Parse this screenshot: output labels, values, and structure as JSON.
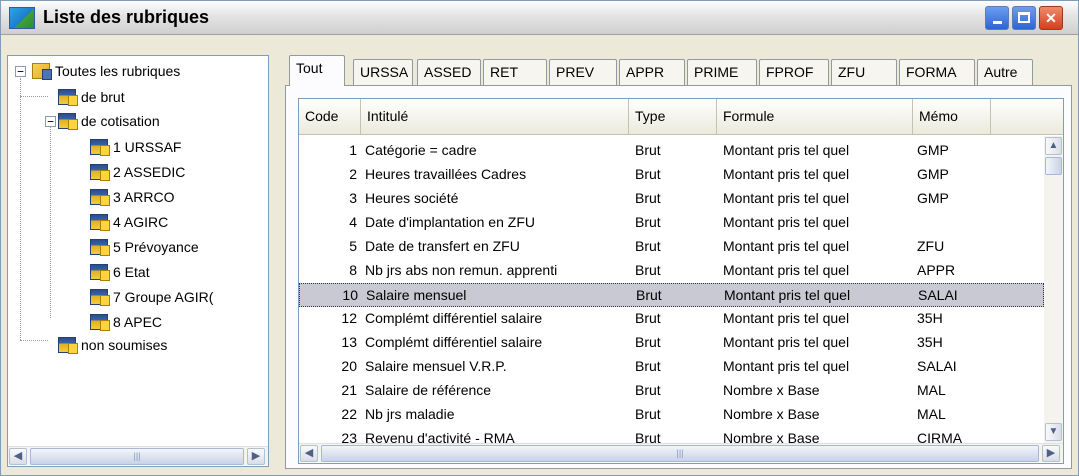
{
  "window": {
    "title": "Liste des rubriques"
  },
  "tree": {
    "root": "Toutes les rubriques",
    "brut": "de brut",
    "cotisation": "de cotisation",
    "children": [
      "1 URSSAF",
      "2 ASSEDIC",
      "3 ARRCO",
      "4 AGIRC",
      "5 Prévoyance",
      "6 Etat",
      "7 Groupe AGIR(",
      "8 APEC"
    ],
    "non_soumises": "non soumises"
  },
  "tabs": [
    "Tout",
    "URSSA",
    "ASSED",
    "RET",
    "PREV",
    "APPR",
    "PRIME",
    "FPROF",
    "ZFU",
    "FORMA",
    "Autre"
  ],
  "columns": [
    "Code",
    "Intitulé",
    "Type",
    "Formule",
    "Mémo"
  ],
  "rows": [
    {
      "code": "1",
      "intitule": "Catégorie = cadre",
      "type": "Brut",
      "formule": "Montant pris tel quel",
      "memo": "GMP"
    },
    {
      "code": "2",
      "intitule": "Heures travaillées Cadres",
      "type": "Brut",
      "formule": "Montant pris tel quel",
      "memo": "GMP"
    },
    {
      "code": "3",
      "intitule": "Heures société",
      "type": "Brut",
      "formule": "Montant pris tel quel",
      "memo": "GMP"
    },
    {
      "code": "4",
      "intitule": "Date d'implantation en ZFU",
      "type": "Brut",
      "formule": "Montant pris tel quel",
      "memo": ""
    },
    {
      "code": "5",
      "intitule": "Date de transfert en ZFU",
      "type": "Brut",
      "formule": "Montant pris tel quel",
      "memo": "ZFU"
    },
    {
      "code": "8",
      "intitule": "Nb jrs abs non remun. apprenti",
      "type": "Brut",
      "formule": "Montant pris tel quel",
      "memo": "APPR"
    },
    {
      "code": "10",
      "intitule": "Salaire mensuel",
      "type": "Brut",
      "formule": "Montant pris tel quel",
      "memo": "SALAI"
    },
    {
      "code": "12",
      "intitule": "Complémt différentiel salaire",
      "type": "Brut",
      "formule": "Montant pris tel quel",
      "memo": "35H"
    },
    {
      "code": "13",
      "intitule": "Complémt différentiel salaire",
      "type": "Brut",
      "formule": "Montant pris tel quel",
      "memo": "35H"
    },
    {
      "code": "20",
      "intitule": "Salaire mensuel V.R.P.",
      "type": "Brut",
      "formule": "Montant pris tel quel",
      "memo": "SALAI"
    },
    {
      "code": "21",
      "intitule": "Salaire de référence",
      "type": "Brut",
      "formule": "Nombre x Base",
      "memo": "MAL"
    },
    {
      "code": "22",
      "intitule": "Nb jrs maladie",
      "type": "Brut",
      "formule": "Nombre x Base",
      "memo": "MAL"
    },
    {
      "code": "23",
      "intitule": "Revenu d'activité - RMA",
      "type": "Brut",
      "formule": "Nombre x Base",
      "memo": "CIRMA"
    }
  ],
  "selected_row": 6
}
